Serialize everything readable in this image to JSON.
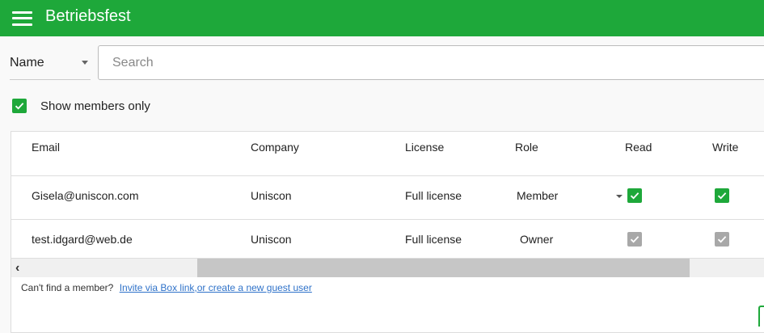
{
  "header": {
    "title": "Betriebsfest",
    "menu_icon": "hamburger-menu-icon",
    "bg_color": "#1ea83a"
  },
  "filter": {
    "selected": "Name",
    "search_placeholder": "Search",
    "search_value": ""
  },
  "members_only": {
    "label": "Show members only",
    "checked": true
  },
  "table": {
    "columns": [
      "Email",
      "Company",
      "License",
      "Role",
      "Read",
      "Write"
    ],
    "rows": [
      {
        "email": "Gisela@uniscon.com",
        "company": "Uniscon",
        "license": "Full license",
        "role": "Member",
        "read": true,
        "write": true,
        "editable": true
      },
      {
        "email": "test.idgard@web.de",
        "company": "Uniscon",
        "license": "Full license",
        "role": "Owner",
        "read": true,
        "write": true,
        "editable": false
      }
    ]
  },
  "footer": {
    "question": "Can't find a member?",
    "link": "Invite via Box link,or create a new guest user"
  }
}
